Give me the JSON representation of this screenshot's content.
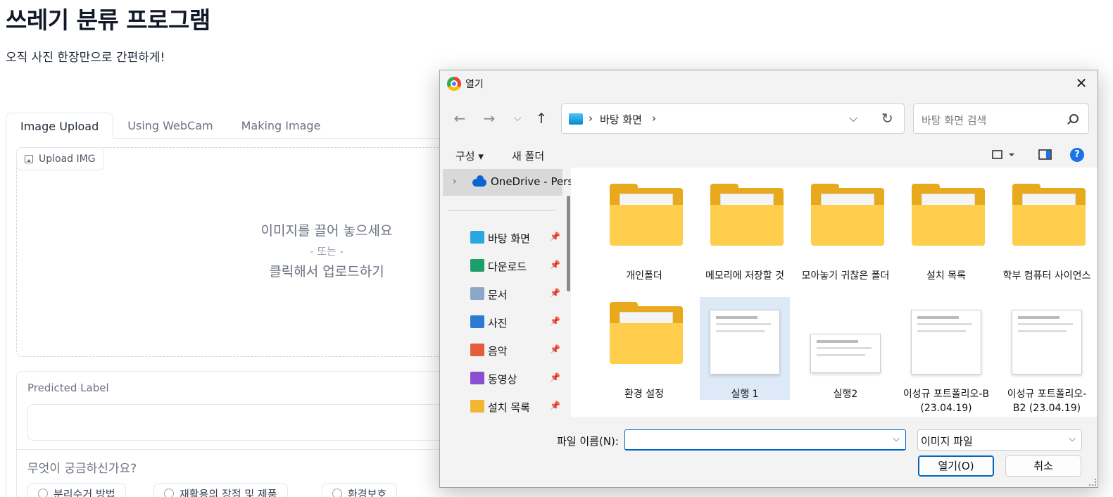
{
  "app": {
    "title": "쓰레기 분류 프로그램",
    "subtitle": "오직 사진 한장만으로 간편하게!",
    "tabs": [
      {
        "label": "Image Upload",
        "active": true
      },
      {
        "label": "Using WebCam",
        "active": false
      },
      {
        "label": "Making Image",
        "active": false
      }
    ],
    "upload_badge": "Upload IMG",
    "drop_line1": "이미지를 끌어 놓으세요",
    "drop_or": "- 또는 -",
    "drop_line2": "클릭해서 업로드하기",
    "predicted_label": "Predicted Label",
    "question_label": "무엇이 궁금하신가요?",
    "radio_options": [
      "분리수거 방법",
      "재활용의 장점 및 제품",
      "환경보호"
    ]
  },
  "dialog": {
    "title": "열기",
    "breadcrumb": [
      "바탕 화면"
    ],
    "search_placeholder": "바탕 화면 검색",
    "commands": {
      "organize": "구성",
      "new_folder": "새 폴더"
    },
    "nav": {
      "onedrive": "OneDrive - Personal",
      "quick_access": [
        {
          "label": "바탕 화면",
          "icon": "desktop-icon",
          "color": "#29a8e0"
        },
        {
          "label": "다운로드",
          "icon": "download-icon",
          "color": "#1e9e6a"
        },
        {
          "label": "문서",
          "icon": "document-icon",
          "color": "#8aa6c8"
        },
        {
          "label": "사진",
          "icon": "pictures-icon",
          "color": "#2b7bd6"
        },
        {
          "label": "음악",
          "icon": "music-icon",
          "color": "#e35d3b"
        },
        {
          "label": "동영상",
          "icon": "video-icon",
          "color": "#8a4fd1"
        },
        {
          "label": "설치 목록",
          "icon": "folder-icon",
          "color": "#f2b632"
        }
      ]
    },
    "files": [
      {
        "name": "개인폴더",
        "type": "folder"
      },
      {
        "name": "메모리에 저장할 것",
        "type": "folder"
      },
      {
        "name": "모아놓기 귀찮은 폴더",
        "type": "folder"
      },
      {
        "name": "설치 목록",
        "type": "folder"
      },
      {
        "name": "학부 컴퓨터 사이언스",
        "type": "folder"
      },
      {
        "name": "환경 설정",
        "type": "folder"
      },
      {
        "name": "실행 1",
        "type": "image",
        "selected": true
      },
      {
        "name": "실행2",
        "type": "image"
      },
      {
        "name": "이성규 포트폴리오-B (23.04.19)",
        "type": "image"
      },
      {
        "name": "이성규 포트폴리오-B2 (23.04.19)",
        "type": "image"
      }
    ],
    "filename_label": "파일 이름(N):",
    "filename_value": "",
    "filetype_value": "이미지 파일",
    "open_button": "열기(O)",
    "cancel_button": "취소"
  }
}
